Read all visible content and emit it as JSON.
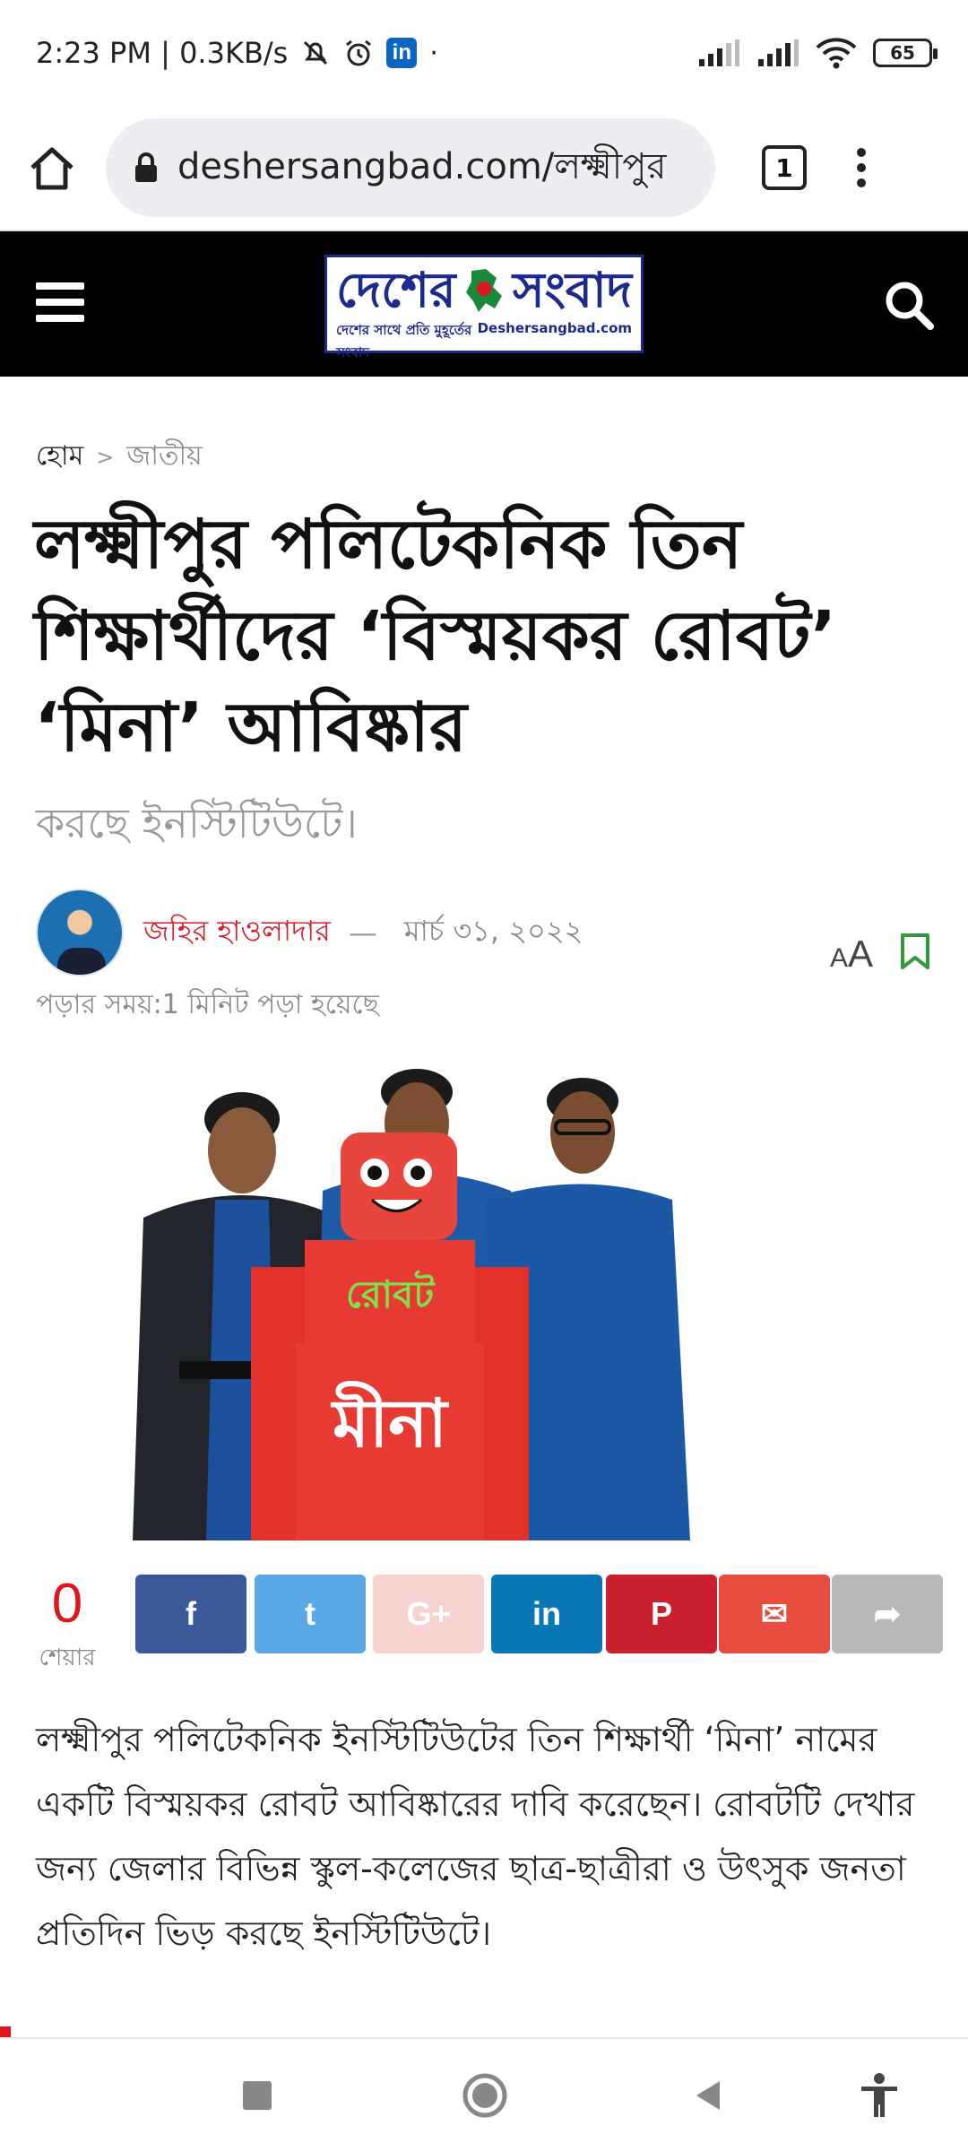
{
  "status_bar": {
    "time_info": "2:23 PM | 0.3KB/s",
    "battery": "65",
    "linkedin_badge": "in"
  },
  "browser": {
    "url": "deshersangbad.com/লক্ষ্মীপুর",
    "tab_count": "1"
  },
  "site": {
    "logo_left": "দেশের",
    "logo_right": "সংবাদ",
    "logo_tagline": "দেশের সাথে প্রতি মুহূর্তের সংবাদ",
    "logo_domain": "Deshersangbad.com"
  },
  "breadcrumb": {
    "home": "হোম",
    "separator": ">",
    "category": "জাতীয়"
  },
  "article": {
    "title": "লক্ষ্মীপুর পলিটেকনিক তিন শিক্ষার্থীদের ‘বিস্ময়কর রোবট’ ‘মিনা’ আবিষ্কার",
    "subtitle": "করছে ইনস্টিটিউটে।",
    "author": "জহির হাওলাদার",
    "dash": "—",
    "date": "মার্চ ৩১, ২০২২",
    "read_time": "পড়ার সময়:1 মিনিট পড়া হয়েছে",
    "font_size_label_small": "A",
    "font_size_label_large": "A",
    "hero_robot_label": "রোবট",
    "hero_robot_name": "মীনা",
    "body": "লক্ষ্মীপুর পলিটেকনিক ইনস্টিটিউটের তিন শিক্ষার্থী ‘মিনা’ নামের একটি বিস্ময়কর রোবট আবিষ্কারের দাবি করেছেন। রোবটটি দেখার জন্য জেলার বিভিন্ন স্কুল-কলেজের ছাত্র-ছাত্রীরা ও উৎসুক জনতা প্রতিদিন ভিড় করছে ইনস্টিটিউটে।"
  },
  "share": {
    "count": "0",
    "count_label": "শেয়ার",
    "buttons": [
      {
        "name": "facebook",
        "glyph": "f",
        "color": "#3b5998"
      },
      {
        "name": "twitter",
        "glyph": "t",
        "color": "#5aa9e6"
      },
      {
        "name": "google-plus",
        "glyph": "G+",
        "color": "#f6d3d1"
      },
      {
        "name": "linkedin",
        "glyph": "in",
        "color": "#0a77b5"
      },
      {
        "name": "pinterest",
        "glyph": "P",
        "color": "#c8202c"
      },
      {
        "name": "email",
        "glyph": "✉",
        "color": "#e74c3c"
      },
      {
        "name": "share",
        "glyph": "➦",
        "color": "#b8b8b8"
      }
    ]
  }
}
